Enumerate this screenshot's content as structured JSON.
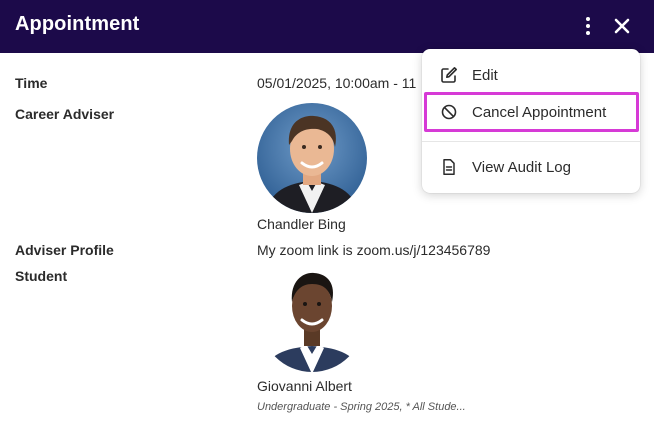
{
  "header": {
    "title": "Appointment",
    "menu_icon": "more-vertical-icon",
    "close_icon": "close-icon"
  },
  "details": {
    "time": {
      "label": "Time",
      "value": "05/01/2025, 10:00am - 11"
    },
    "career_adviser": {
      "label": "Career Adviser",
      "name": "Chandler Bing"
    },
    "adviser_profile": {
      "label": "Adviser Profile",
      "value": "My zoom link is zoom.us/j/123456789"
    },
    "student": {
      "label": "Student",
      "name": "Giovanni Albert",
      "info": "Undergraduate - Spring 2025, * All Stude..."
    }
  },
  "menu": {
    "items": [
      {
        "label": "Edit",
        "icon": "edit-icon"
      },
      {
        "label": "Cancel Appointment",
        "icon": "cancel-icon"
      },
      {
        "label": "View Audit Log",
        "icon": "document-icon"
      }
    ]
  },
  "colors": {
    "header_bg": "#1c0a4a",
    "highlight": "#d63ad6"
  }
}
